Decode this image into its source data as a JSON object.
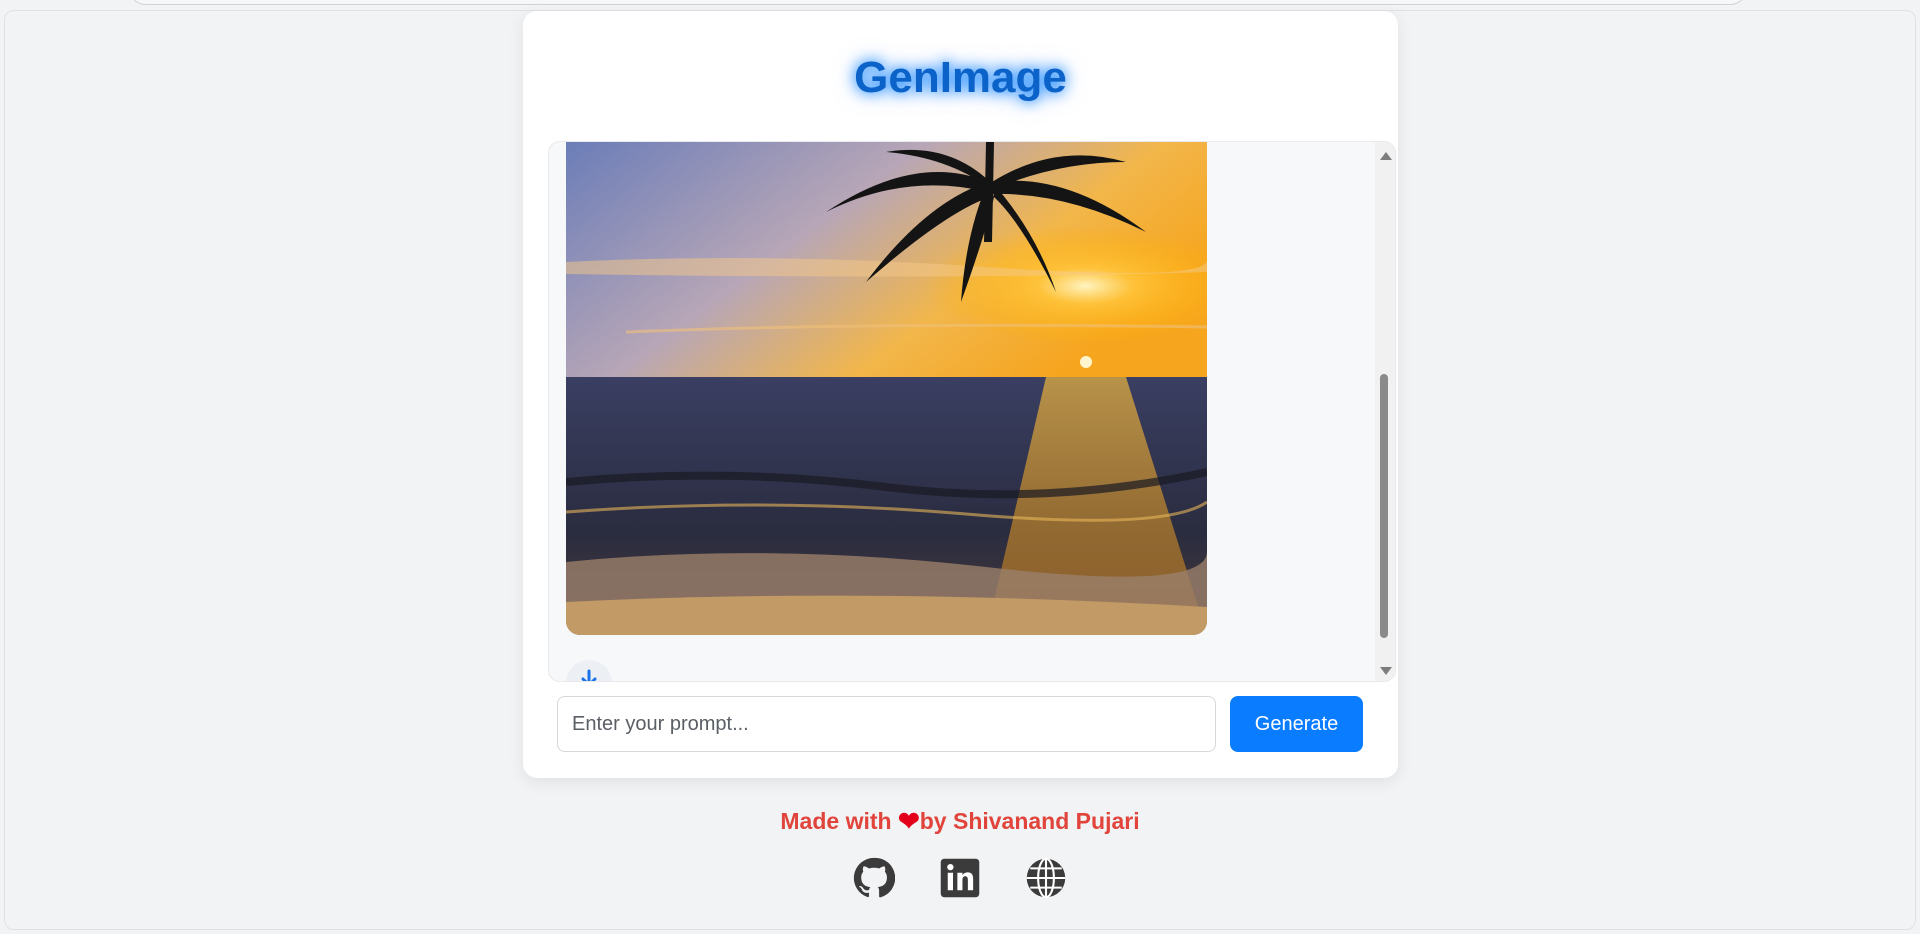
{
  "app": {
    "title": "GenImage"
  },
  "chat": {
    "image_alt": "Generated image: palm tree silhouette over an ocean sunset beach",
    "download_icon": "download-icon"
  },
  "prompt": {
    "placeholder": "Enter your prompt...",
    "value": ""
  },
  "actions": {
    "generate_label": "Generate"
  },
  "footer": {
    "made_with": "Made with ",
    "by": "by Shivanand Pujari",
    "heart_icon": "heart-icon",
    "links": [
      {
        "icon": "github-icon"
      },
      {
        "icon": "linkedin-icon"
      },
      {
        "icon": "globe-icon"
      }
    ]
  },
  "colors": {
    "accent": "#0a7cff",
    "title": "#0b63c9",
    "footer_text": "#e0443a",
    "heart": "#e3001b"
  }
}
